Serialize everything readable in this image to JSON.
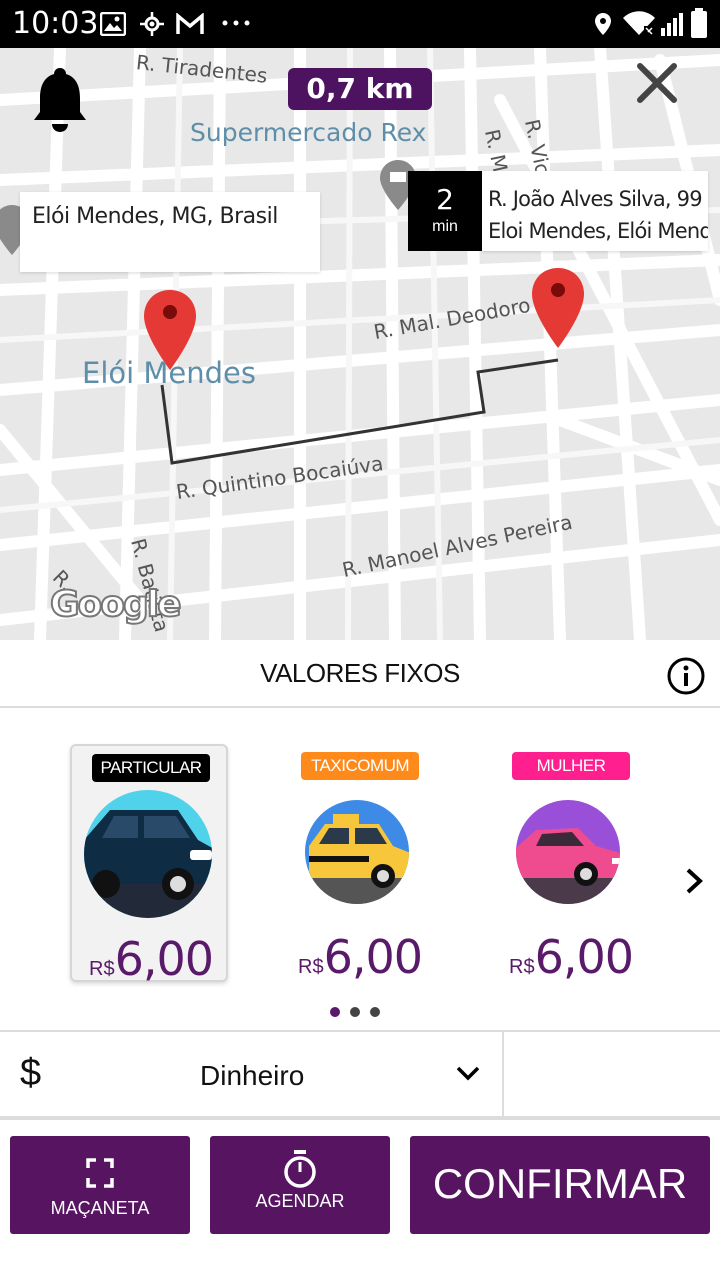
{
  "status_bar": {
    "time": "10:03"
  },
  "map": {
    "distance": "0,7 km",
    "origin_address": "Elói Mendes, MG, Brasil",
    "eta": {
      "value": "2",
      "unit": "min"
    },
    "destination_address": [
      "R. João Alves Silva, 99 -",
      "Eloi Mendes, Elói Mendes -"
    ],
    "street_labels": {
      "tiradentes": "R. Tiradentes",
      "mal_deodoro": "R. Mal. Deodoro",
      "quintino": "R. Quintino Bocaiúva",
      "manoel": "R. Manoel Alves Pereira",
      "batista": "R. Batista",
      "mano": "R. Mano",
      "vicen": "R. Vicen",
      "r_left": "R."
    },
    "poi_supermercado": "Supermercado Rex",
    "city_label": "Elói Mendes",
    "google": "Google",
    "icons": {
      "bell": "bell-icon",
      "close": "close-icon"
    }
  },
  "section": {
    "title": "VALORES FIXOS"
  },
  "categories": [
    {
      "badge": "PARTICULAR",
      "badge_color": "#000000",
      "currency": "R$",
      "price": "6,00",
      "selected": true
    },
    {
      "badge": "TAXICOMUM",
      "badge_color": "#ff8a1c",
      "currency": "R$",
      "price": "6,00",
      "selected": false
    },
    {
      "badge": "MULHER",
      "badge_color": "#ff1f8e",
      "currency": "R$",
      "price": "6,00",
      "selected": false
    }
  ],
  "payment": {
    "symbol": "$",
    "method": "Dinheiro"
  },
  "buttons": {
    "macaneta": "MAÇANETA",
    "agendar": "AGENDAR",
    "confirmar": "CONFIRMAR"
  },
  "colors": {
    "primary": "#561461",
    "accent_price": "#5a1a6a"
  }
}
